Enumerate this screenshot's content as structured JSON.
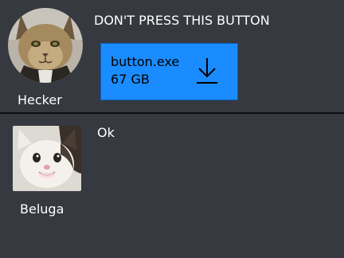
{
  "messages": [
    {
      "username": "Hecker",
      "avatar_icon": "caracal-cat-avatar",
      "text": "DON'T PRESS THIS BUTTON",
      "attachment": {
        "file_name": "button.exe",
        "file_size": "67 GB",
        "icon": "download-icon",
        "color": "#1a8cff"
      }
    },
    {
      "username": "Beluga",
      "avatar_icon": "beluga-cat-avatar",
      "text": "Ok"
    }
  ],
  "colors": {
    "background": "#36393f",
    "divider": "#0f1012",
    "attachment_bg": "#1a8cff",
    "text": "#ffffff"
  }
}
